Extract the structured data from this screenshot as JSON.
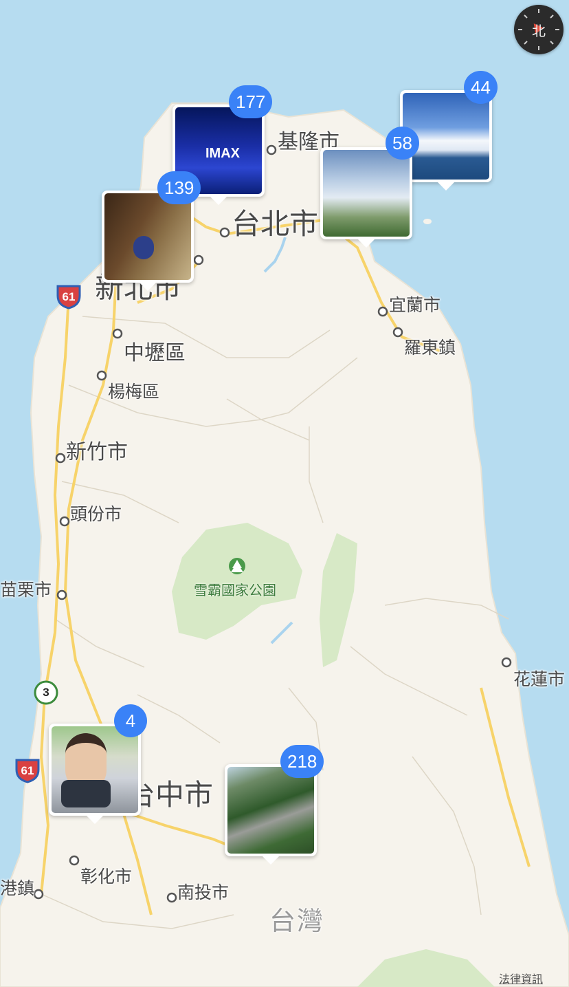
{
  "map": {
    "place_labels": {
      "keelung": "基隆市",
      "taipei": "台北市",
      "new_taipei": "新北市",
      "zhongli": "中壢區",
      "yangmei": "楊梅區",
      "hsinchu": "新竹市",
      "toufen": "頭份市",
      "miaoli": "苗栗市",
      "yilan": "宜蘭市",
      "luodong": "羅東鎮",
      "hualien": "花蓮市",
      "taichung": "台中市",
      "changhua": "彰化市",
      "nantou": "南投市",
      "lugang": "港鎮",
      "taiwan": "台灣"
    },
    "park_label": "雪霸國家公園",
    "route_shields": [
      "61",
      "61",
      "3"
    ],
    "legal_link": "法律資訊",
    "compass_label": "北"
  },
  "photo_pins": [
    {
      "count": "177",
      "thumb_text": "IMAX"
    },
    {
      "count": "139"
    },
    {
      "count": "58"
    },
    {
      "count": "44"
    },
    {
      "count": "4"
    },
    {
      "count": "218"
    }
  ],
  "colors": {
    "sea": "#b6dcf0",
    "land": "#f6f3ec",
    "road": "#f7d36a",
    "park": "#d7e9c6",
    "badge": "#3a82f7"
  },
  "icons": [
    "compass-icon",
    "park-tree-icon",
    "route-shield-icon",
    "city-dot-icon"
  ]
}
